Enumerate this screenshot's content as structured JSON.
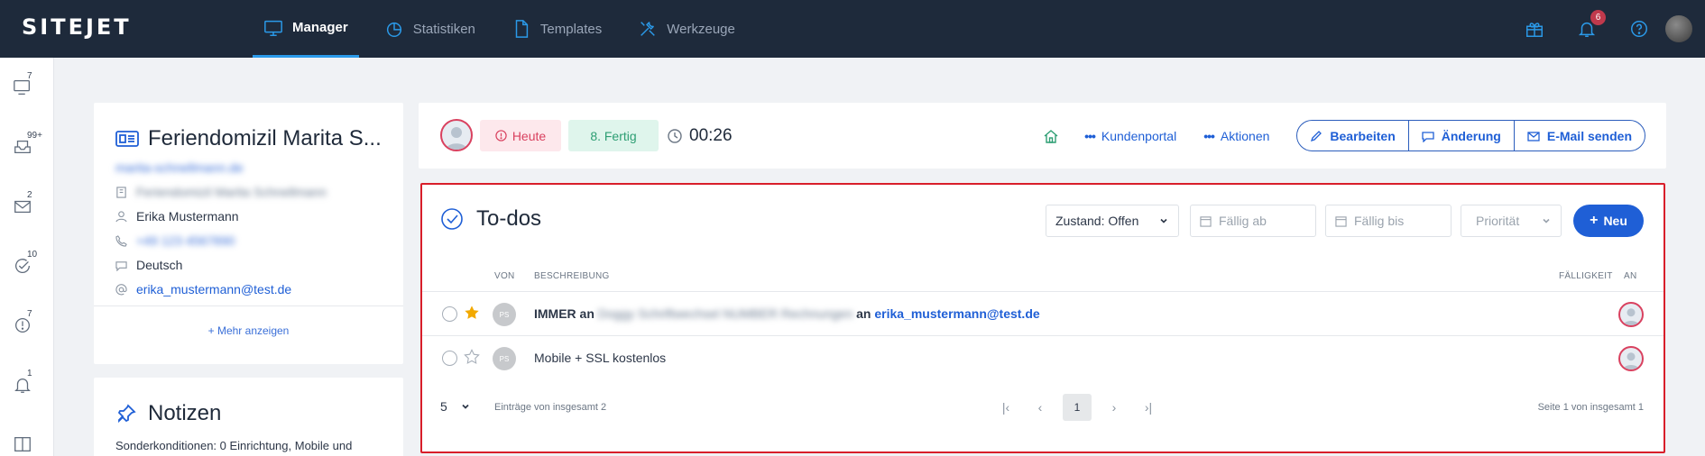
{
  "topbar": {
    "logo": "SITEJET",
    "tabs": [
      {
        "label": "Manager",
        "icon": "monitor-icon",
        "active": true
      },
      {
        "label": "Statistiken",
        "icon": "pie-chart-icon",
        "active": false
      },
      {
        "label": "Templates",
        "icon": "document-icon",
        "active": false
      },
      {
        "label": "Werkzeuge",
        "icon": "tools-icon",
        "active": false
      }
    ],
    "notification_count": "6",
    "accent_color": "#2b9ae9"
  },
  "rail": {
    "items": [
      {
        "icon": "monitor-icon",
        "badge": "7"
      },
      {
        "icon": "inbox-icon",
        "badge": "99+"
      },
      {
        "icon": "mail-icon",
        "badge": "2"
      },
      {
        "icon": "check-refresh-icon",
        "badge": "10"
      },
      {
        "icon": "alert-clock-icon",
        "badge": "7"
      },
      {
        "icon": "bell-icon",
        "badge": "1"
      },
      {
        "icon": "columns-icon",
        "badge": ""
      }
    ]
  },
  "customer": {
    "title": "Feriendomizil Marita S...",
    "domain": "marita-schnellmann.de",
    "company": "Feriendomizil Marita Schnellmann",
    "contact": "Erika Mustermann",
    "phone": "+49 123 4567890",
    "language": "Deutsch",
    "email": "erika_mustermann@test.de",
    "more": "+ Mehr anzeigen"
  },
  "notes": {
    "title": "Notizen",
    "text": "Sonderkonditionen: 0 Einrichtung, Mobile und"
  },
  "actionbar": {
    "due": "Heute",
    "status": "8. Fertig",
    "timer": "00:26",
    "kundenportal": "Kundenportal",
    "aktionen": "Aktionen",
    "bearbeiten": "Bearbeiten",
    "aenderung": "Änderung",
    "email_senden": "E-Mail senden",
    "due_color": "#d9415f",
    "status_color": "#2d9e73"
  },
  "todos": {
    "title": "To-dos",
    "filter_state": "Zustand: Offen",
    "filter_from_placeholder": "Fällig ab",
    "filter_to_placeholder": "Fällig bis",
    "filter_priority": "Priorität",
    "new_button": "Neu",
    "columns": {
      "von": "VON",
      "beschreibung": "BESCHREIBUNG",
      "faelligkeit": "FÄLLIGKEIT",
      "an": "AN"
    },
    "rows": [
      {
        "starred": true,
        "initials": "PS",
        "prefix": "IMMER an",
        "blurred": "Doggy Schriftwechsel NUMBER Rechnungen",
        "middle": "an",
        "email": "erika_mustermann@test.de",
        "plain": ""
      },
      {
        "starred": false,
        "initials": "PS",
        "prefix": "",
        "blurred": "",
        "middle": "",
        "email": "",
        "plain": "Mobile + SSL kostenlos"
      }
    ],
    "page_size": "5",
    "entries_text": "Einträge von insgesamt 2",
    "current_page": "1",
    "page_info": "Seite 1 von insgesamt 1"
  }
}
